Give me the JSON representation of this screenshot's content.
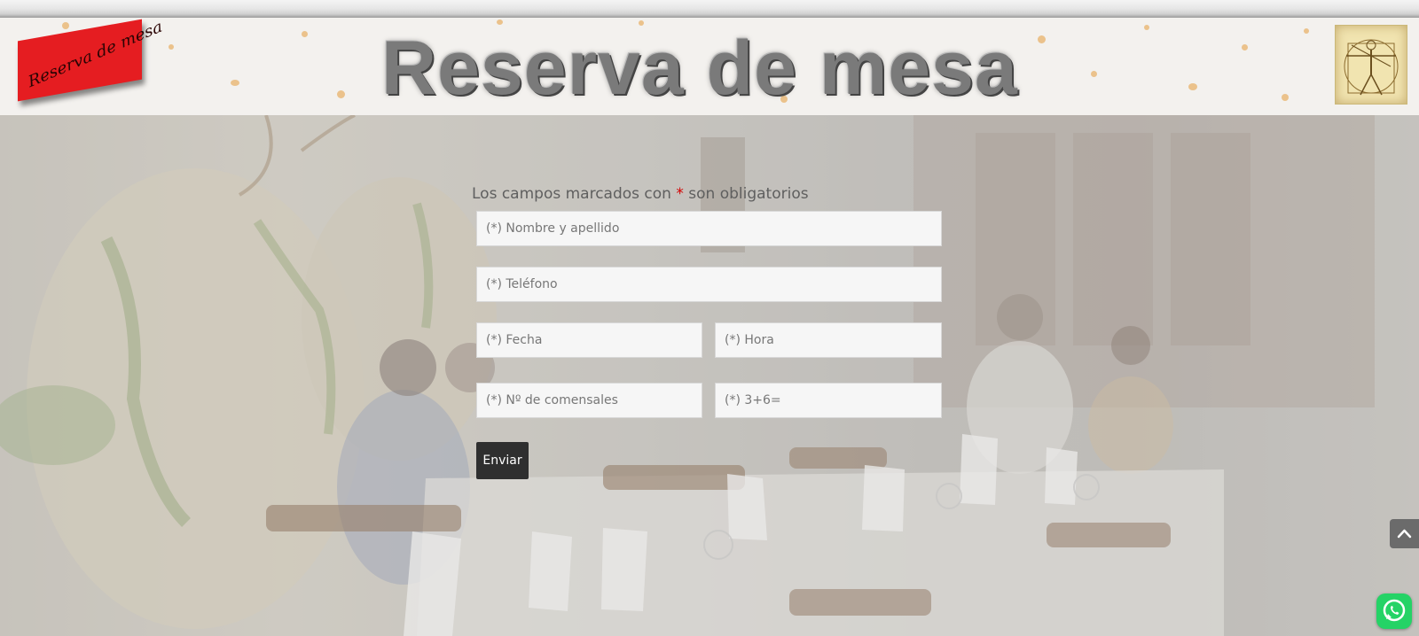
{
  "banner": {
    "title": "Reserva de mesa",
    "sign_text": "Reserva de mesa"
  },
  "form": {
    "required_note_prefix": "Los campos marcados con",
    "required_marker": "*",
    "required_note_suffix": "son obligatorios",
    "name_placeholder": "(*) Nombre y apellido",
    "phone_placeholder": "(*) Teléfono",
    "date_placeholder": "(*) Fecha",
    "time_placeholder": "(*) Hora",
    "guests_placeholder": "(*) Nº de comensales",
    "captcha_placeholder": "(*) 3+6=",
    "submit_label": "Enviar"
  },
  "icons": {
    "scroll_top": "chevron-up-icon",
    "chat": "whatsapp-icon"
  },
  "colors": {
    "required": "#d40000",
    "submit_bg": "#2f2f2f",
    "sign_red": "#e51d21",
    "whatsapp": "#25d366"
  }
}
